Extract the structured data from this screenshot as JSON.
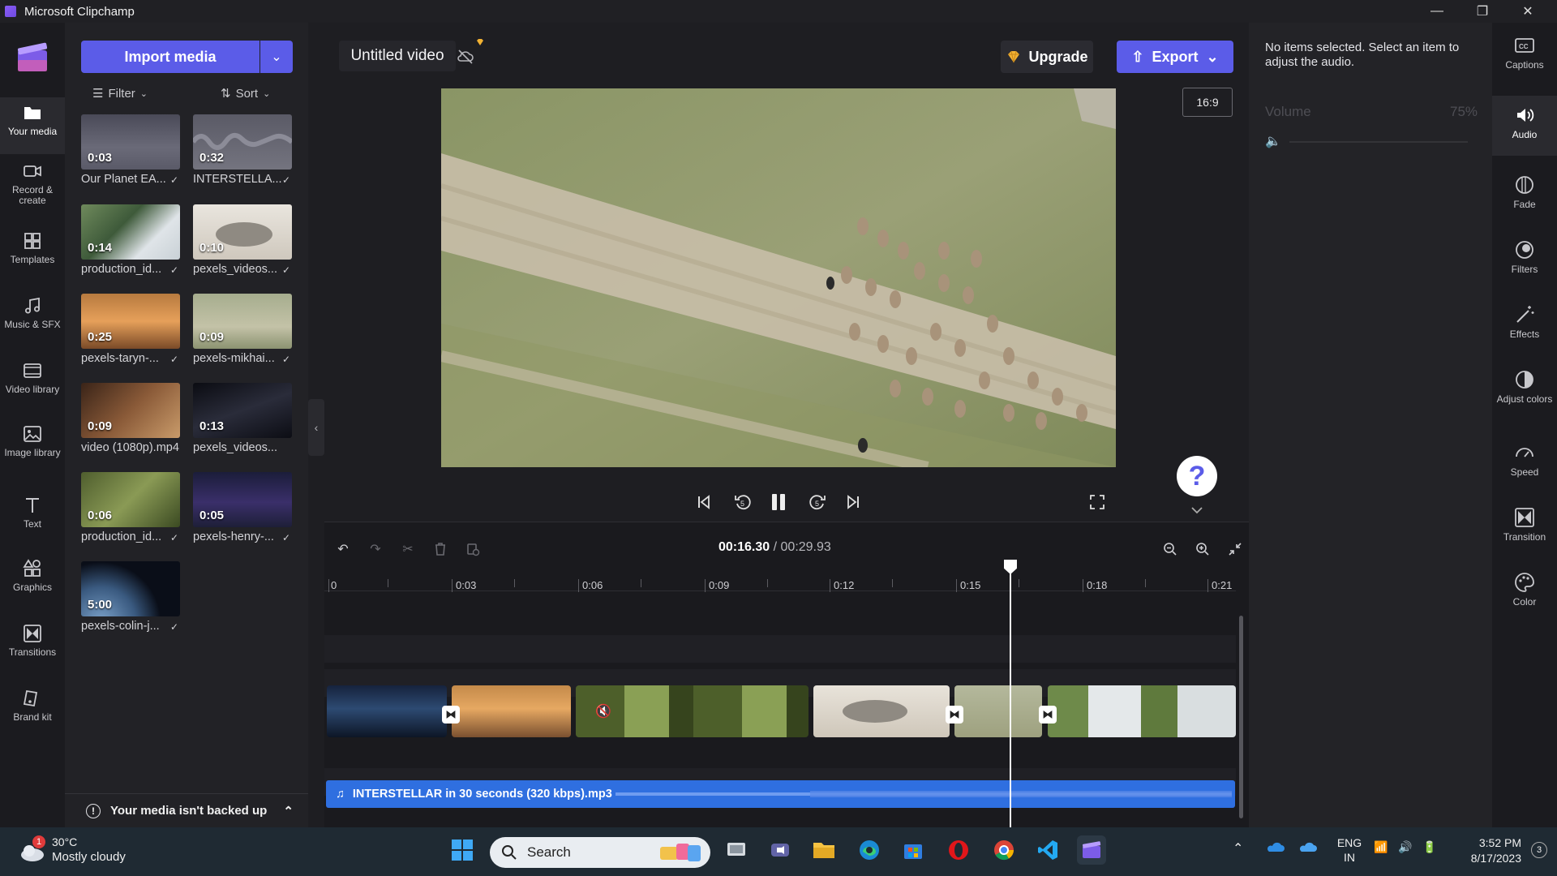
{
  "window": {
    "title": "Microsoft Clipchamp",
    "minimize": "—",
    "restore": "❐",
    "close": "✕"
  },
  "leftnav": {
    "items": [
      {
        "label": "Your media"
      },
      {
        "label": "Record & create"
      },
      {
        "label": "Templates"
      },
      {
        "label": "Music & SFX"
      },
      {
        "label": "Video library"
      },
      {
        "label": "Image library"
      },
      {
        "label": "Text"
      },
      {
        "label": "Graphics"
      },
      {
        "label": "Transitions"
      },
      {
        "label": "Brand kit"
      }
    ]
  },
  "media": {
    "import_label": "Import media",
    "filter_label": "Filter",
    "sort_label": "Sort",
    "items": [
      {
        "duration": "0:03",
        "name": "Our Planet EA..."
      },
      {
        "duration": "0:32",
        "name": "INTERSTELLA..."
      },
      {
        "duration": "0:14",
        "name": "production_id..."
      },
      {
        "duration": "0:10",
        "name": "pexels_videos..."
      },
      {
        "duration": "0:25",
        "name": "pexels-taryn-..."
      },
      {
        "duration": "0:09",
        "name": "pexels-mikhai..."
      },
      {
        "duration": "0:09",
        "name": "video (1080p).mp4"
      },
      {
        "duration": "0:13",
        "name": "pexels_videos..."
      },
      {
        "duration": "0:06",
        "name": "production_id..."
      },
      {
        "duration": "0:05",
        "name": "pexels-henry-..."
      },
      {
        "duration": "5:00",
        "name": "pexels-colin-j..."
      }
    ],
    "backup_text": "Your media isn't backed up"
  },
  "editor": {
    "project_title": "Untitled video",
    "upgrade_label": "Upgrade",
    "export_label": "Export",
    "aspect_ratio": "16:9",
    "help_label": "?"
  },
  "timeline": {
    "current_time": "00:16.30",
    "total_time": "/ 00:29.93",
    "ruler": [
      "0",
      "0:03",
      "0:06",
      "0:09",
      "0:12",
      "0:15",
      "0:18",
      "0:21"
    ],
    "audio_clip_name": "INTERSTELLAR in 30 seconds (320 kbps).mp3"
  },
  "audio_panel": {
    "message": "No items selected. Select an item to adjust the audio.",
    "volume_label": "Volume",
    "volume_value": "75%"
  },
  "rightnav": {
    "items": [
      {
        "label": "Captions"
      },
      {
        "label": "Audio"
      },
      {
        "label": "Fade"
      },
      {
        "label": "Filters"
      },
      {
        "label": "Effects"
      },
      {
        "label": "Adjust colors"
      },
      {
        "label": "Speed"
      },
      {
        "label": "Transition"
      },
      {
        "label": "Color"
      }
    ]
  },
  "taskbar": {
    "weather_temp": "30°C",
    "weather_desc": "Mostly cloudy",
    "weather_badge": "1",
    "search_placeholder": "Search",
    "lang_top": "ENG",
    "lang_bottom": "IN",
    "time": "3:52 PM",
    "date": "8/17/2023",
    "notif_count": "3"
  },
  "colors": {
    "accent": "#5b5ce8",
    "audio_track": "#2f6fe0",
    "background": "#1e1e22"
  }
}
